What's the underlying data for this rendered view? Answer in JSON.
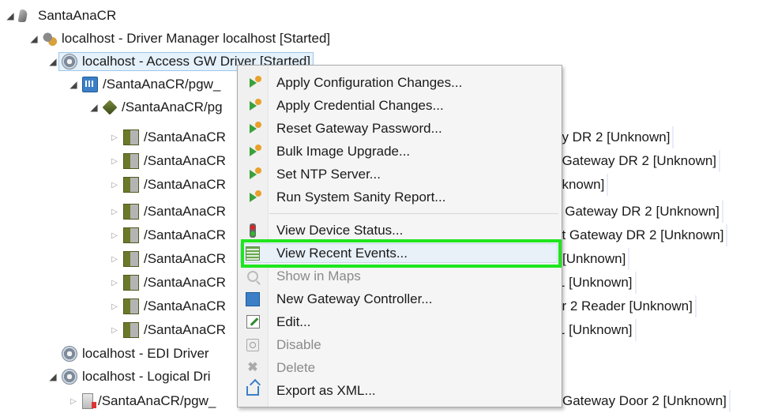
{
  "tree": {
    "root": "SantaAnaCR",
    "driver_manager": "localhost - Driver Manager localhost [Started]",
    "access_gw_driver": "localhost - Access GW Driver [Started]",
    "controller": "/SantaAnaCR/pgw_",
    "gateway": "/SantaAnaCR/pg",
    "readers": [
      {
        "left": "/SantaAnaCR",
        "right": "ay DR 2 [Unknown]"
      },
      {
        "left": "/SantaAnaCR",
        "right": "t Gateway DR 2 [Unknown]"
      },
      {
        "left": "/SantaAnaCR",
        "right": "nknown]"
      },
      {
        "left": "/SantaAnaCR",
        "right": "k Gateway DR 2 [Unknown]"
      },
      {
        "left": "/SantaAnaCR",
        "right": "ut Gateway DR 2 [Unknown]"
      },
      {
        "left": "/SantaAnaCR",
        "right": "[Unknown]"
      },
      {
        "left": "/SantaAnaCR",
        "right": "1 [Unknown]"
      },
      {
        "left": "/SantaAnaCR",
        "right": "or 2 Reader [Unknown]"
      },
      {
        "left": "/SantaAnaCR",
        "right": "1 [Unknown]"
      }
    ],
    "edi_driver": "localhost - EDI Driver",
    "logical_driver": "localhost - Logical Dri",
    "door_left": "/SantaAnaCR/pgw_",
    "door_right": "Gateway Door 2 [Unknown]"
  },
  "context_menu": {
    "items": [
      {
        "label": "Apply Configuration Changes...",
        "icon": "apply-icon",
        "enabled": true
      },
      {
        "label": "Apply Credential Changes...",
        "icon": "apply-icon",
        "enabled": true
      },
      {
        "label": "Reset Gateway Password...",
        "icon": "apply-icon",
        "enabled": true
      },
      {
        "label": "Bulk Image Upgrade...",
        "icon": "apply-icon",
        "enabled": true
      },
      {
        "label": "Set NTP Server...",
        "icon": "apply-icon",
        "enabled": true
      },
      {
        "label": "Run System Sanity Report...",
        "icon": "apply-icon",
        "enabled": true
      },
      {
        "label": "View Device Status...",
        "icon": "traffic-light-icon",
        "enabled": true
      },
      {
        "label": "View Recent Events...",
        "icon": "event-list-icon",
        "enabled": true
      },
      {
        "label": "Show in Maps",
        "icon": "magnifier-icon",
        "enabled": false
      },
      {
        "label": "New Gateway Controller...",
        "icon": "controller-icon",
        "enabled": true
      },
      {
        "label": "Edit...",
        "icon": "edit-icon",
        "enabled": true
      },
      {
        "label": "Disable",
        "icon": "disable-icon",
        "enabled": false
      },
      {
        "label": "Delete",
        "icon": "delete-icon",
        "enabled": false
      },
      {
        "label": "Export as XML...",
        "icon": "export-icon",
        "enabled": true
      }
    ],
    "highlighted_item": "View Recent Events...",
    "highlight_color": "#1ee61e"
  }
}
